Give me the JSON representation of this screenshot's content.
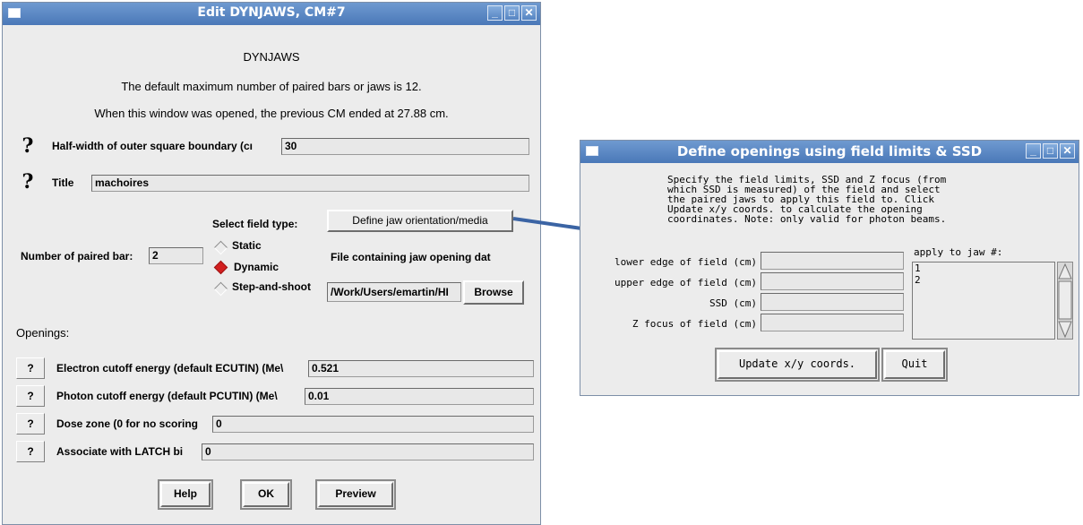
{
  "win1": {
    "title": "Edit DYNJAWS, CM#7",
    "heading": "DYNJAWS",
    "info1": "The default maximum number of paired bars or jaws is 12.",
    "info2": "When this window was opened, the previous CM ended at 27.88 cm.",
    "halfwidth_label": "Half-width of outer square boundary (cı",
    "halfwidth_value": "30",
    "title_label": "Title",
    "title_value": "machoires",
    "select_type_label": "Select field type:",
    "define_btn": "Define jaw orientation/media",
    "num_pairs_label": "Number of paired bar:",
    "num_pairs_value": "2",
    "radio_static": "Static",
    "radio_dynamic": "Dynamic",
    "radio_step": "Step-and-shoot",
    "file_label": "File containing jaw opening dat",
    "file_value": "/Work/Users/emartin/HI",
    "browse_btn": "Browse",
    "openings_label": "Openings:",
    "rows": [
      {
        "label": "Electron cutoff energy (default ECUTIN) (Me\\",
        "value": "0.521"
      },
      {
        "label": "Photon cutoff energy (default PCUTIN) (Me\\",
        "value": "0.01"
      },
      {
        "label": "Dose zone (0 for no scoring",
        "value": "0"
      },
      {
        "label": "Associate with LATCH bi",
        "value": "0"
      }
    ],
    "help_btn": "Help",
    "ok_btn": "OK",
    "preview_btn": "Preview",
    "q_small": "?",
    "q_big": "?"
  },
  "win2": {
    "title": "Define openings using field limits & SSD",
    "instructions": [
      "Specify the field limits, SSD and Z focus (from",
      "which SSD is measured) of the field and select",
      "the paired jaws to apply this field to.  Click",
      "Update x/y coords. to calculate the opening",
      "coordinates.  Note: only valid for photon beams."
    ],
    "apply_label": "apply to jaw #:",
    "fields": [
      {
        "label": "lower edge of field (cm)",
        "value": ""
      },
      {
        "label": "upper edge of field (cm)",
        "value": ""
      },
      {
        "label": "SSD (cm)",
        "value": ""
      },
      {
        "label": "Z focus of field (cm)",
        "value": ""
      }
    ],
    "jaws": [
      "1",
      "2"
    ],
    "update_btn": "Update x/y coords.",
    "quit_btn": "Quit"
  },
  "colors": {
    "titlebar": "#5a86c4",
    "arrow": "#3b64a4",
    "radio_on": "#d21f1f"
  }
}
